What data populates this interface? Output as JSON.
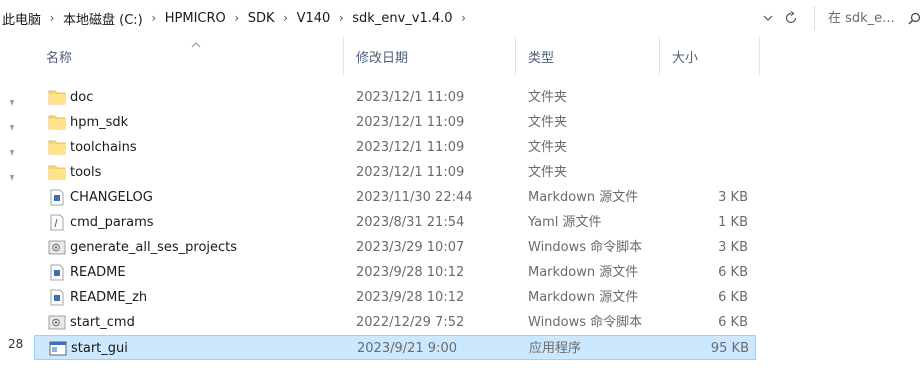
{
  "breadcrumb": [
    "此电脑",
    "本地磁盘 (C:)",
    "HPMICRO",
    "SDK",
    "V140",
    "sdk_env_v1.4.0"
  ],
  "breadcrumb_separator": "›",
  "search": {
    "placeholder": "在 sdk_e..."
  },
  "nav": {
    "number": "28"
  },
  "columns": {
    "name": "名称",
    "date": "修改日期",
    "type": "类型",
    "size": "大小"
  },
  "files": [
    {
      "name": "doc",
      "date": "2023/12/1 11:09",
      "type": "文件夹",
      "size": "",
      "icon": "folder-icon"
    },
    {
      "name": "hpm_sdk",
      "date": "2023/12/1 11:09",
      "type": "文件夹",
      "size": "",
      "icon": "folder-icon"
    },
    {
      "name": "toolchains",
      "date": "2023/12/1 11:09",
      "type": "文件夹",
      "size": "",
      "icon": "folder-icon"
    },
    {
      "name": "tools",
      "date": "2023/12/1 11:09",
      "type": "文件夹",
      "size": "",
      "icon": "folder-icon"
    },
    {
      "name": "CHANGELOG",
      "date": "2023/11/30 22:44",
      "type": "Markdown 源文件",
      "size": "3 KB",
      "icon": "markdown-file-icon"
    },
    {
      "name": "cmd_params",
      "date": "2023/8/31 21:54",
      "type": "Yaml 源文件",
      "size": "1 KB",
      "icon": "yaml-file-icon"
    },
    {
      "name": "generate_all_ses_projects",
      "date": "2023/3/29 10:07",
      "type": "Windows 命令脚本",
      "size": "3 KB",
      "icon": "script-file-icon"
    },
    {
      "name": "README",
      "date": "2023/9/28 10:12",
      "type": "Markdown 源文件",
      "size": "6 KB",
      "icon": "markdown-file-icon"
    },
    {
      "name": "README_zh",
      "date": "2023/9/28 10:12",
      "type": "Markdown 源文件",
      "size": "6 KB",
      "icon": "markdown-file-icon"
    },
    {
      "name": "start_cmd",
      "date": "2022/12/29 7:52",
      "type": "Windows 命令脚本",
      "size": "6 KB",
      "icon": "script-file-icon"
    },
    {
      "name": "start_gui",
      "date": "2023/9/21 9:00",
      "type": "应用程序",
      "size": "95 KB",
      "icon": "application-icon",
      "selected": true
    }
  ]
}
